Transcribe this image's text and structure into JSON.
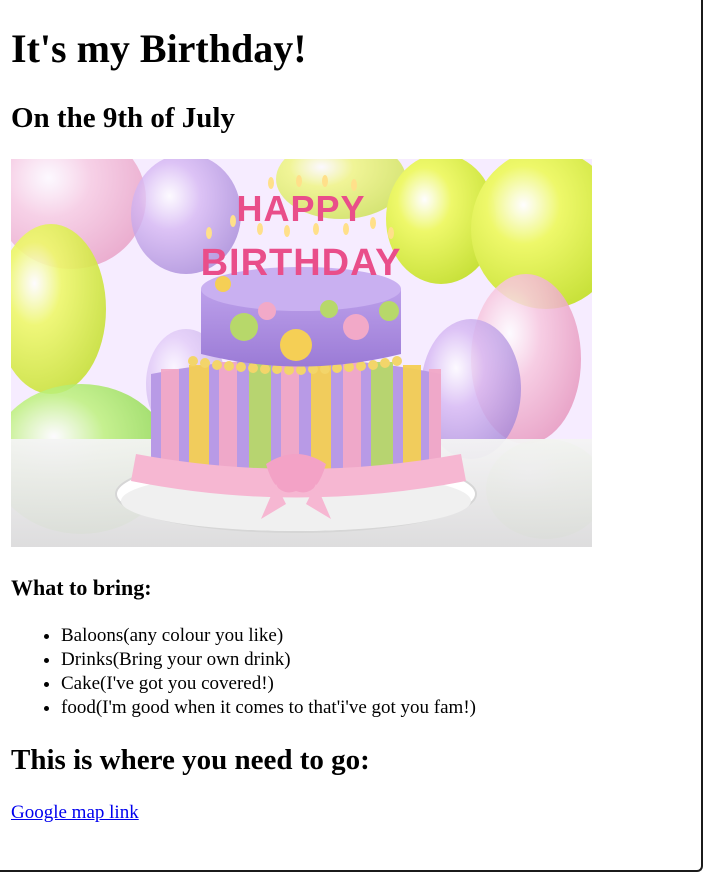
{
  "page": {
    "title": "It's my Birthday!",
    "date": "On the 9th of July",
    "hero_image": {
      "alt": "",
      "cake_topper_line1": "HAPPY",
      "cake_topper_line2": "BIRTHDAY",
      "colors": {
        "balloon_yellow": "#e7f64a",
        "balloon_purple": "#c7a4ea",
        "balloon_green": "#a9e66a",
        "balloon_pink": "#f3b8d6",
        "cake_purple": "#b99ae8",
        "cake_pink": "#f2a9c8",
        "cake_yellow": "#f5cf55",
        "cake_green": "#b7d86a"
      }
    },
    "bring_heading": "What to bring:",
    "bring_items": [
      "Baloons(any colour you like)",
      "Drinks(Bring your own drink)",
      "Cake(I've got you covered!)",
      "food(I'm good when it comes to that'i've got you fam!)"
    ],
    "where_heading": "This is where you need to go:",
    "map_link_label": "Google map link"
  }
}
